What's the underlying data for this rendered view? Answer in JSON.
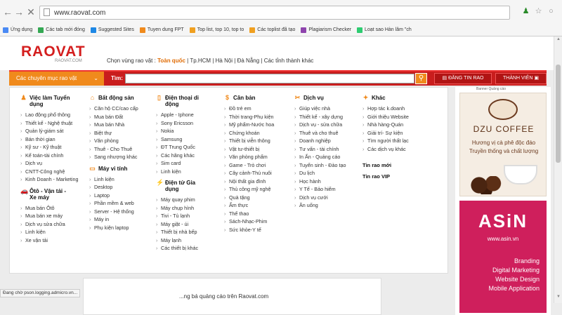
{
  "browser": {
    "url": "www.raovat.com",
    "bookmarks": [
      {
        "label": "Ứng dụng",
        "color": "#4a8af4"
      },
      {
        "label": "Các tab mới đóng",
        "color": "#34a853"
      },
      {
        "label": "Suggested Sites",
        "color": "#1e88e5"
      },
      {
        "label": "Tuyen dung FPT",
        "color": "#f08a1c"
      },
      {
        "label": "Top list, top 10, top to",
        "color": "#f0a020"
      },
      {
        "label": "Các toplist đã tạo",
        "color": "#f0a020"
      },
      {
        "label": "Plagiarism Checker",
        "color": "#8e44ad"
      },
      {
        "label": "Loạt sao Hàn lâm \"ch",
        "color": "#2ecc71"
      }
    ]
  },
  "header": {
    "logo": "RAOVAT",
    "logo_sub": "RAOVAT.COM",
    "region_prefix": "Chọn vùng rao vặt :",
    "region_selected": "Toàn quốc",
    "regions": "| Tp.HCM | Hà Nội | Đà Nẵng | Các tỉnh thành khác"
  },
  "search": {
    "categories_label": "Các chuyên mục rao vặt",
    "tim_label": "Tìm:",
    "post_label": "ĐĂNG TIN RAO",
    "member_label": "THÀNH VIÊN"
  },
  "columns": [
    {
      "cats": [
        {
          "icon": "person-icon",
          "glyph": "♟",
          "title": "Việc làm Tuyển dụng",
          "items": [
            "Lao động phổ thông",
            "Thiết kế - Nghệ thuật",
            "Quản lý-giám sát",
            "Bán thời gian",
            "Kỹ sư - Kỹ thuật",
            "Kế toán-tài chính",
            "Dịch vụ",
            "CNTT-Công nghệ",
            "Kinh Doanh - Marketing"
          ]
        },
        {
          "icon": "car-icon",
          "glyph": "🚗",
          "title": "Ôtô - Vận tải - Xe máy",
          "items": [
            "Mua bán Ôtô",
            "Mua bán xe máy",
            "Dịch vụ sửa chữa",
            "Linh kiện",
            "Xe vận tải"
          ]
        }
      ]
    },
    {
      "cats": [
        {
          "icon": "house-icon",
          "glyph": "⌂",
          "title": "Bất động sản",
          "items": [
            "Căn hộ CC/cao cấp",
            "Mua bán Đất",
            "Mua bán Nhà",
            "Biệt thự",
            "Văn phòng",
            "Thuê - Cho Thuê",
            "Sang nhượng khác"
          ]
        },
        {
          "icon": "computer-icon",
          "glyph": "▭",
          "title": "Máy vi tính",
          "items": [
            "Linh kiện",
            "Desktop",
            "Laptop",
            "Phần mềm & web",
            "Server - Hệ thống",
            "Máy in",
            "Phụ kiện laptop"
          ]
        }
      ]
    },
    {
      "cats": [
        {
          "icon": "phone-icon",
          "glyph": "▯",
          "title": "Điện thoại di động",
          "items": [
            "Apple - Iphone",
            "Sony Ericsson",
            "Nokia",
            "Samsung",
            "ĐT Trung Quốc",
            "Các hãng khác",
            "Sim card",
            "Linh kiện"
          ]
        },
        {
          "icon": "plug-icon",
          "glyph": "⚡",
          "title": "Điện tử Gia dụng",
          "items": [
            "Máy quay phim",
            "Máy chụp hình",
            "Tivi - Tủ lạnh",
            "Máy giặt - úi",
            "Thiết bị nhà bếp",
            "Máy lạnh",
            "Các thiết bị khác"
          ]
        }
      ]
    },
    {
      "cats": [
        {
          "icon": "dollar-icon",
          "glyph": "$",
          "title": "Căn bản",
          "items": [
            "Đồ trẻ em",
            "Thời trang-Phụ kiện",
            "Mỹ phẩm-Nước hoa",
            "Chứng khoán",
            "Thiết bị viễn thông",
            "Vật tư-thiết bị",
            "Văn phòng phẩm",
            "Game - Trò chơi",
            "Cây cảnh-Thú nuôi",
            "Nội thất gia đình",
            "Thủ công mỹ nghệ",
            "Quà tặng",
            "Ẩm thực",
            "Thể thao",
            "Sách-Nhạc-Phim",
            "Sức khỏe-Y tế"
          ]
        }
      ]
    },
    {
      "cats": [
        {
          "icon": "tools-icon",
          "glyph": "✂",
          "title": "Dịch vụ",
          "items": [
            "Giúp việc nhà",
            "Thiết kế - xây dựng",
            "Dịch vụ - sửa chữa",
            "Thuê và cho thuê",
            "Doanh nghiệp",
            "Tư vấn - tài chính",
            "In Ấn - Quảng cáo",
            "Tuyển sinh - Đào tạo",
            "Du lịch",
            "Học hành",
            "Y Tế - Bảo hiểm",
            "Dịch vụ cưới",
            "Ăn uống"
          ]
        }
      ]
    },
    {
      "cats": [
        {
          "icon": "handshake-icon",
          "glyph": "✦",
          "title": "Khác",
          "items": [
            "Hợp tác k.doanh",
            "Giới thiệu Website",
            "Nhà hàng-Quán",
            "Giải trí- Sự kiện",
            "Tìm người thất lạc",
            "Các dịch vụ khác"
          ]
        }
      ],
      "extra": [
        "Tin rao mới",
        "Tin rao VIP"
      ]
    }
  ],
  "bottom": {
    "text": "...ng bá quảng cáo trên Raovat.com"
  },
  "ads": {
    "label": "Banner Quảng cáo",
    "coffee_name": "DZU COFFEE",
    "coffee_line1": "Hương vị cà phê độc đáo",
    "coffee_line2": "Truyền thống và chất lượng",
    "asin_logo": "ASiN",
    "asin_url": "www.asin.vn",
    "asin_services": [
      "Branding",
      "Digital Marketing",
      "Website Design",
      "Mobile Application"
    ]
  },
  "status": "Đang chờ pson.logging.admicro.vn..."
}
